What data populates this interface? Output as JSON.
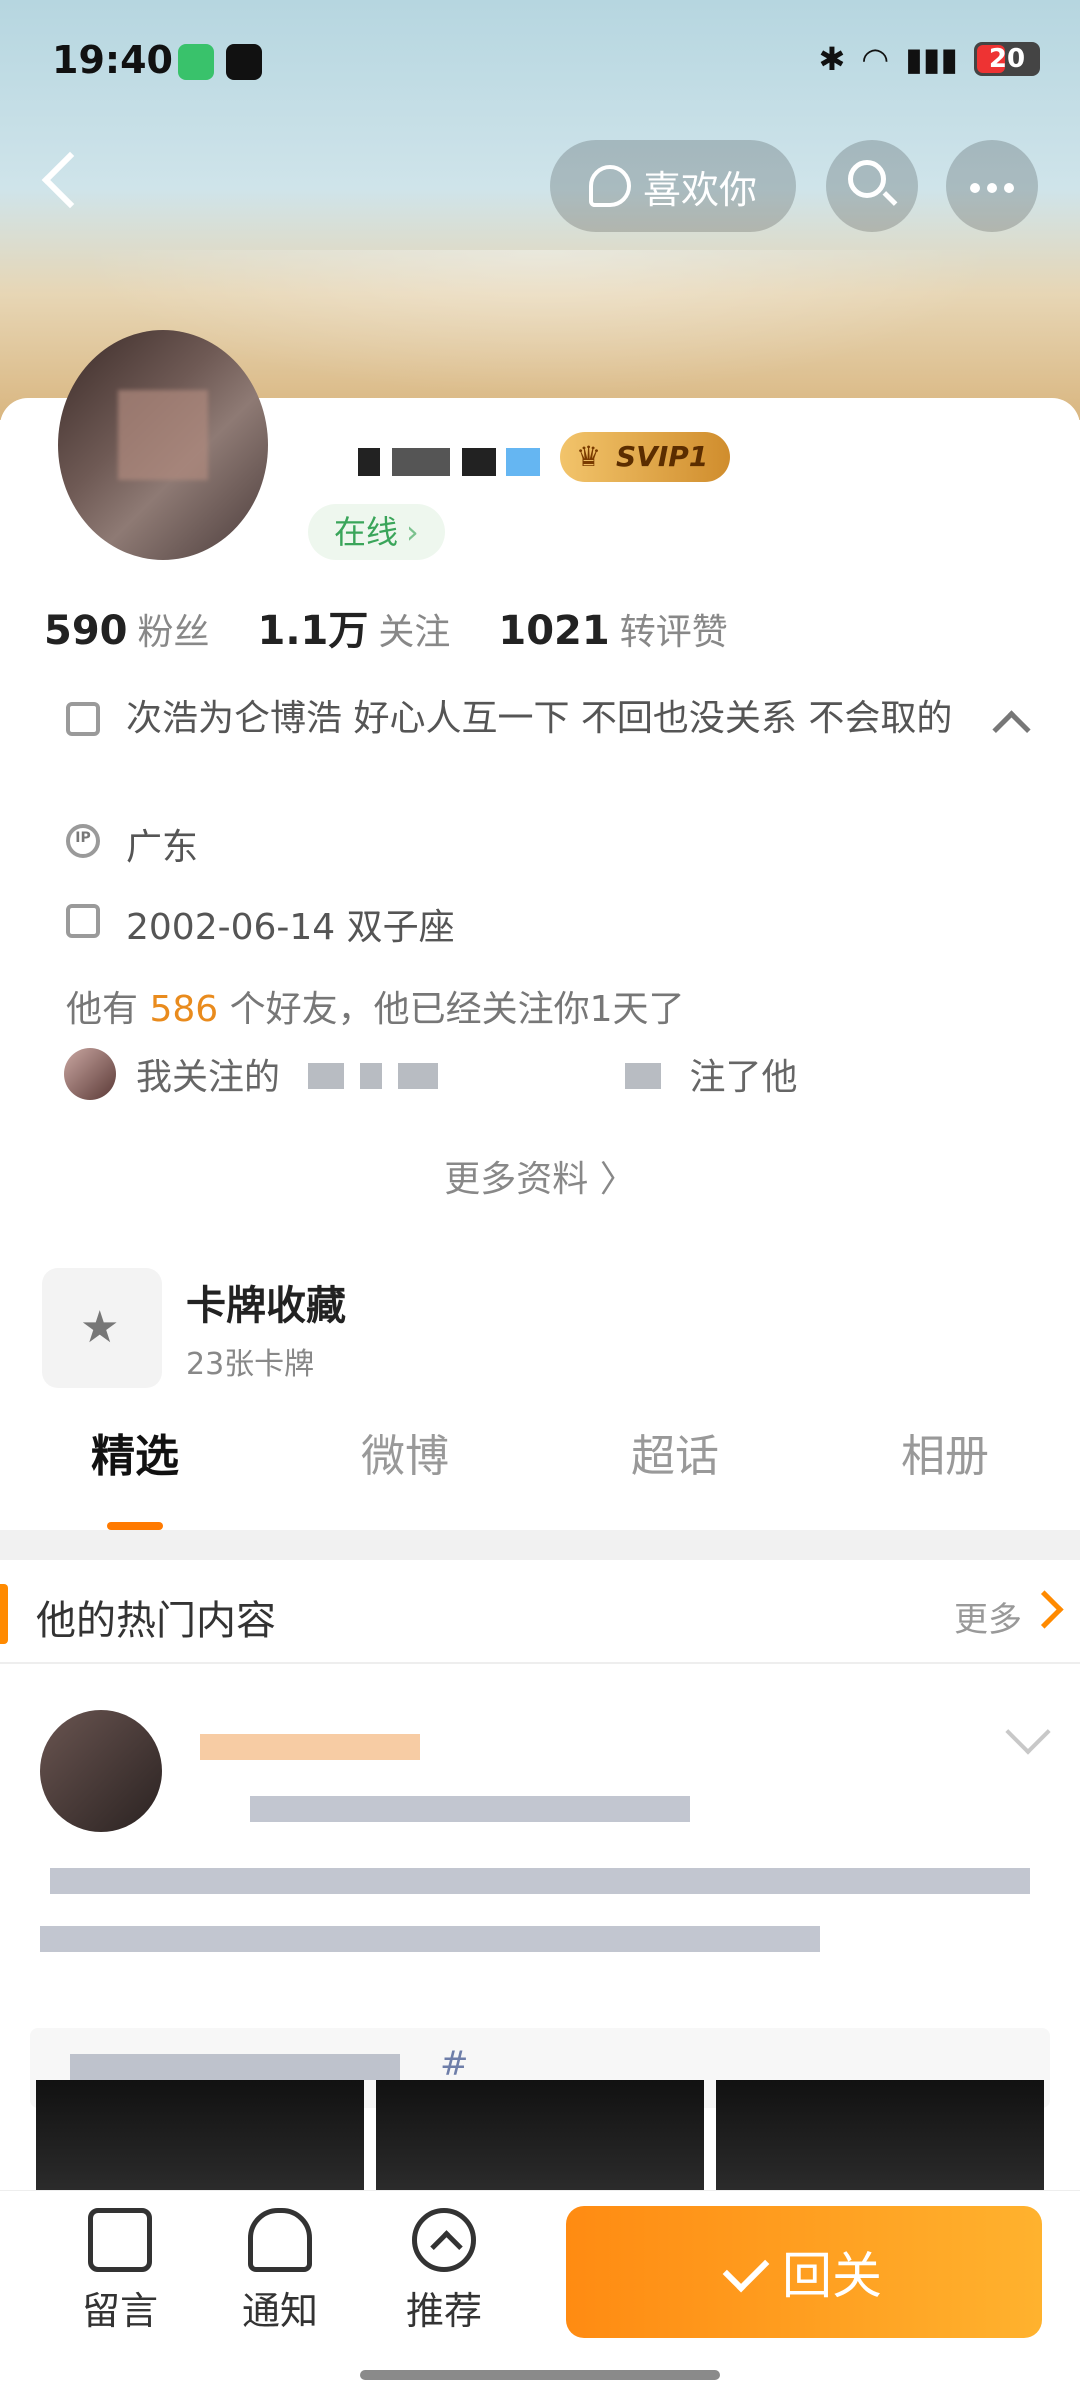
{
  "status_bar": {
    "time": "19:40",
    "battery": "20"
  },
  "header": {
    "like_button_label": "喜欢你"
  },
  "profile": {
    "svip_badge": "SVIP1",
    "online_label": "在线",
    "stats": [
      {
        "value": "590",
        "label": "粉丝"
      },
      {
        "value": "1.1万",
        "label": "关注"
      },
      {
        "value": "1021",
        "label": "转评赞"
      }
    ],
    "bio": "次浩为仑博浩 好心人互一下 不回也没关系 不会取的",
    "location": "广东",
    "birthday": "2002-06-14 双子座",
    "friends_prefix": "他有",
    "friends_count": "586",
    "friends_suffix": "个好友，他已经关注你1天了",
    "mutual_prefix": "我关注的",
    "mutual_suffix": "注了他",
    "more_info": "更多资料 〉"
  },
  "card_collection": {
    "title": "卡牌收藏",
    "subtitle": "23张卡牌"
  },
  "tabs": [
    {
      "label": "精选",
      "active": true
    },
    {
      "label": "微博",
      "active": false
    },
    {
      "label": "超话",
      "active": false
    },
    {
      "label": "相册",
      "active": false
    }
  ],
  "hot_section": {
    "title": "他的热门内容",
    "more": "更多"
  },
  "post": {
    "hashtag_suffix": "#"
  },
  "bottom_nav": {
    "message": "留言",
    "notify": "通知",
    "recommend": "推荐",
    "follow_back": "回关"
  },
  "colors": {
    "accent": "#ff8a00",
    "online": "#3aa55a"
  }
}
